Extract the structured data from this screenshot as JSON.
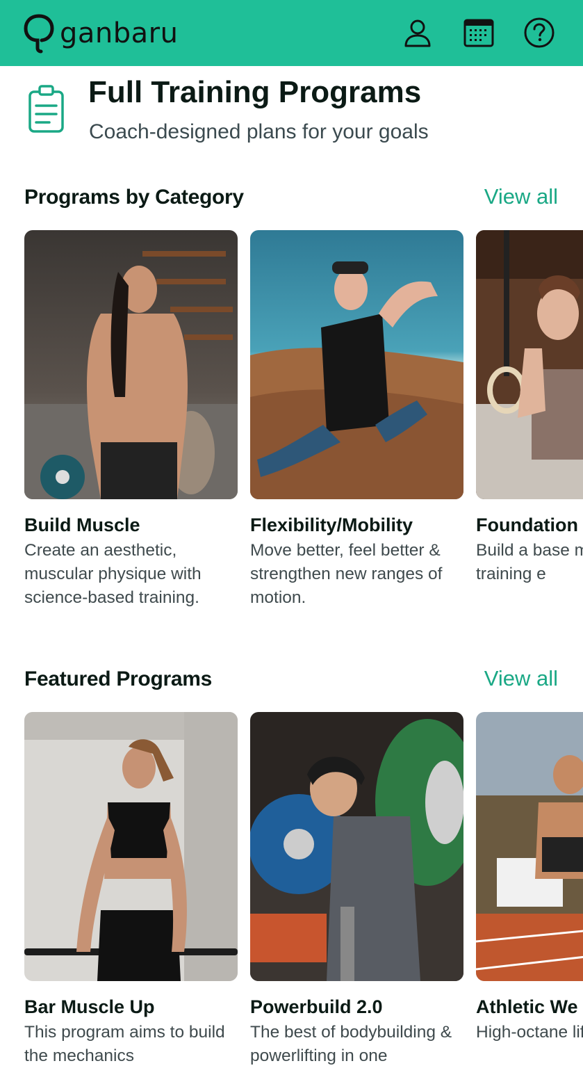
{
  "app": {
    "brand": "ganbaru"
  },
  "header": {
    "title": "Full Training Programs",
    "subtitle": "Coach-designed plans for your goals",
    "icons": [
      "profile-icon",
      "calendar-icon",
      "help-icon",
      "clipboard-icon"
    ]
  },
  "categories": {
    "title": "Programs by Category",
    "view_all": "View all",
    "items": [
      {
        "title": "Build Muscle",
        "desc": "Create an aesthetic, muscular physique with science-based training."
      },
      {
        "title": "Flexibility/Mobility",
        "desc": "Move better, feel better & strengthen new ranges of motion."
      },
      {
        "title": "Foundation",
        "desc": "Build a base movement & No training e"
      }
    ]
  },
  "featured": {
    "title": "Featured Programs",
    "view_all": "View all",
    "items": [
      {
        "title": "Bar Muscle Up",
        "desc": "This program aims to build the mechanics"
      },
      {
        "title": "Powerbuild 2.0",
        "desc": "The best of bodybuilding & powerlifting in one"
      },
      {
        "title": "Athletic We",
        "desc": "High-octane lifting & sprir"
      }
    ]
  },
  "colors": {
    "brand": "#1fbf98",
    "link": "#1aa885"
  }
}
